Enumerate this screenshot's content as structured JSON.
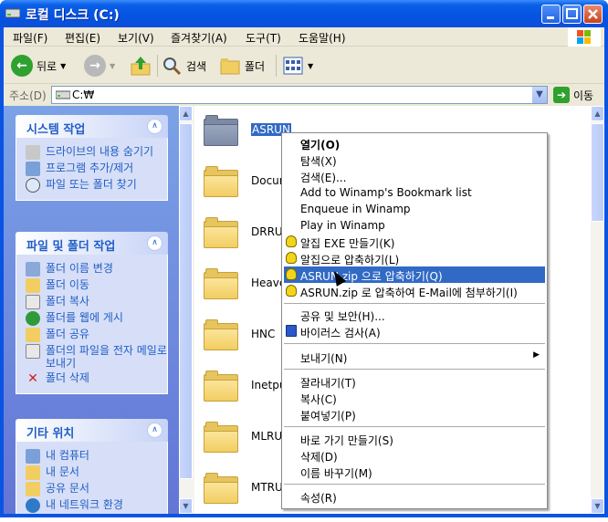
{
  "window": {
    "title": "로컬 디스크 (C:)"
  },
  "menu": [
    "파일(F)",
    "편집(E)",
    "보기(V)",
    "즐겨찾기(A)",
    "도구(T)",
    "도움말(H)"
  ],
  "toolbar": {
    "back": "뒤로",
    "search": "검색",
    "folders": "폴더"
  },
  "address": {
    "label": "주소(D)",
    "value": "C:₩",
    "go": "이동"
  },
  "taskpane": {
    "system": {
      "title": "시스템 작업",
      "items": [
        "드라이브의 내용 숨기기",
        "프로그램 추가/제거",
        "파일 또는 폴더 찾기"
      ]
    },
    "filetasks": {
      "title": "파일 및 폴더 작업",
      "items": [
        "폴더 이름 변경",
        "폴더 이동",
        "폴더 복사",
        "폴더를 웹에 게시",
        "폴더 공유",
        "폴더의 파일을 전자 메일로 보내기",
        "폴더 삭제"
      ]
    },
    "other": {
      "title": "기타 위치",
      "items": [
        "내 컴퓨터",
        "내 문서",
        "공유 문서",
        "내 네트워크 환경"
      ]
    }
  },
  "folders": [
    "ASRUN",
    "Docun",
    "DRRUN",
    "Heave",
    "HNC",
    "Inetpu",
    "MLRU",
    "MTRU"
  ],
  "context_menu": {
    "open": "열기(O)",
    "explore": "탐색(X)",
    "search": "검색(E)...",
    "winamp_bookmark": "Add to Winamp's Bookmark list",
    "winamp_enqueue": "Enqueue in Winamp",
    "winamp_play": "Play in Winamp",
    "alzip_exe": "알집 EXE 만들기(K)",
    "alzip_compress": "알집으로 압축하기(L)",
    "alzip_zip": "ASRUN.zip 으로 압축하기(Q)",
    "alzip_email": "ASRUN.zip 로 압축하여 E-Mail에 첨부하기(I)",
    "share": "공유 및 보안(H)...",
    "virus": "바이러스 검사(A)",
    "sendto": "보내기(N)",
    "cut": "잘라내기(T)",
    "copy": "복사(C)",
    "paste": "붙여넣기(P)",
    "shortcut": "바로 가기 만들기(S)",
    "delete": "삭제(D)",
    "rename": "이름 바꾸기(M)",
    "properties": "속성(R)"
  }
}
